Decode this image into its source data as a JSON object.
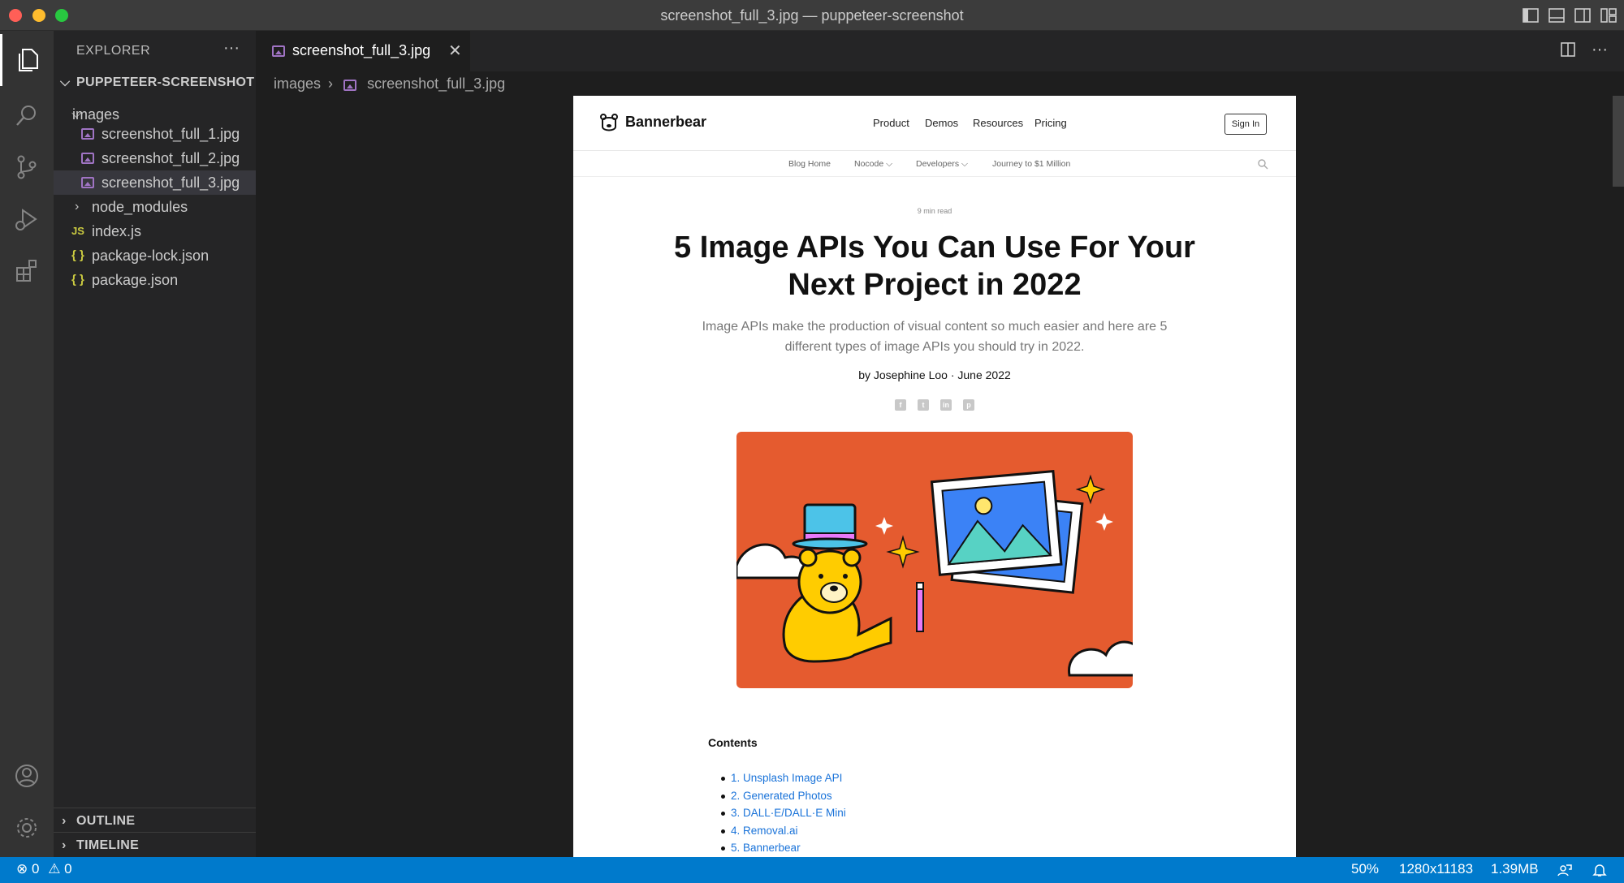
{
  "window": {
    "title": "screenshot_full_3.jpg — puppeteer-screenshot"
  },
  "activity_bar": [
    "explorer",
    "search",
    "source-control",
    "run-and-debug",
    "extensions",
    "accounts",
    "manage"
  ],
  "sidebar": {
    "title": "EXPLORER",
    "more": "···",
    "root": "PUPPETEER-SCREENSHOT",
    "tree": [
      {
        "label": "images",
        "kind": "folder-open"
      },
      {
        "label": "screenshot_full_1.jpg",
        "kind": "image"
      },
      {
        "label": "screenshot_full_2.jpg",
        "kind": "image"
      },
      {
        "label": "screenshot_full_3.jpg",
        "kind": "image",
        "selected": true
      },
      {
        "label": "node_modules",
        "kind": "folder-closed"
      },
      {
        "label": "index.js",
        "kind": "js"
      },
      {
        "label": "package-lock.json",
        "kind": "json"
      },
      {
        "label": "package.json",
        "kind": "json"
      }
    ],
    "icons": {
      "js": "JS",
      "json": "{ }"
    },
    "outline": "OUTLINE",
    "timeline": "TIMELINE"
  },
  "editor": {
    "tab_label": "screenshot_full_3.jpg",
    "tab_close": "✕",
    "breadcrumb": {
      "folder": "images",
      "sep": "›",
      "file": "screenshot_full_3.jpg"
    }
  },
  "preview": {
    "brand": "Bannerbear",
    "nav": [
      "Product",
      "Demos",
      "Resources",
      "Pricing"
    ],
    "sign_in": "Sign In",
    "subnav": [
      "Blog Home",
      "Nocode ⌵",
      "Developers ⌵",
      "Journey to $1 Million"
    ],
    "read_time": "9 min read",
    "title": "5 Image APIs You Can Use For Your Next Project in 2022",
    "description": "Image APIs make the production of visual content so much easier and here are 5 different types of image APIs you should try in 2022.",
    "byline": "by Josephine Loo · June 2022",
    "social": [
      "f",
      "t",
      "in",
      "p"
    ],
    "contents_heading": "Contents",
    "toc": [
      "1. Unsplash Image API",
      "2. Generated Photos",
      "3. DALL·E/DALL·E Mini",
      "4. Removal.ai",
      "5. Bannerbear"
    ],
    "hero_colors": {
      "background": "#e55b2f",
      "bear": "#ffcc00",
      "hat": "#4cc3e8",
      "photo": "#3b82f6"
    }
  },
  "status_bar": {
    "errors": "0",
    "warnings": "0",
    "zoom": "50%",
    "dimensions": "1280x11183",
    "size": "1.39MB"
  },
  "colors": {
    "accent": "#007acc",
    "titlebar": "#3c3c3c",
    "activitybar": "#333333",
    "sidebar": "#252526",
    "editor": "#1e1e1e",
    "link": "#1a73d9"
  }
}
